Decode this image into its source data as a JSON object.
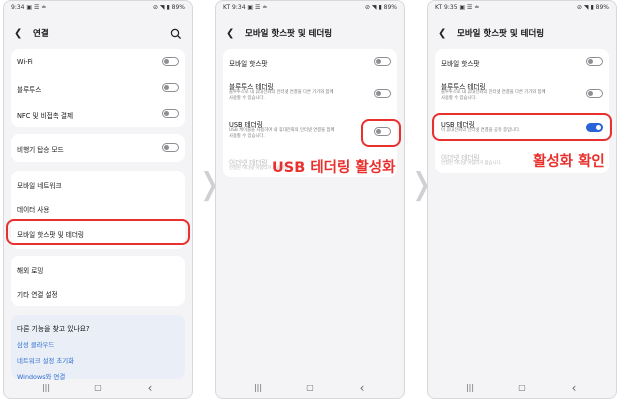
{
  "screens": [
    {
      "status_left": "9:34 ▣ ☰ ≐",
      "status_right": "⊘ ◥ ▮ 89%",
      "title": "연결",
      "items": [
        {
          "label": "Wi-Fi"
        },
        {
          "label": "블루투스"
        },
        {
          "label": "NFC 및 비접촉 결제"
        },
        {
          "label": "비행기 탑승 모드"
        },
        {
          "label": "모바일 네트워크"
        },
        {
          "label": "데이터 사용"
        },
        {
          "label": "모바일 핫스팟 및 테더링"
        },
        {
          "label": "해외 로밍"
        },
        {
          "label": "기타 연결 설정"
        }
      ],
      "suggest": {
        "title": "다른 기능을 찾고 있나요?",
        "links": [
          "삼성 클라우드",
          "네트워크 설정 초기화",
          "Windows와 연결"
        ]
      }
    },
    {
      "status_left": "KT 9:34 ▣ ☰ ≐",
      "status_right": "⊘ ◥ ▮ 89%",
      "title": "모바일 핫스팟 및 테더링",
      "items": [
        {
          "label": "모바일 핫스팟"
        },
        {
          "label": "블루투스 테더링",
          "desc1": "블루투스로 내 휴대전화의 인터넷 연결을 다른 기기와 함께",
          "desc2": "사용할 수 있습니다."
        },
        {
          "label": "USB 테더링",
          "desc1": "USB 케이블을 사용하여 내 휴대전화의 인터넷 연결을 함께",
          "desc2": "사용할 수 있습니다."
        },
        {
          "label": "이더넷 테더링",
          "desc1": "연결된 이더넷 어댑터가 없습니다."
        }
      ],
      "callout": "USB 테더링 활성화"
    },
    {
      "status_left": "KT 9:35 ▣ ☰ ≐",
      "status_right": "⊘ ◥ ▮ 89%",
      "title": "모바일 핫스팟 및 테더링",
      "items": [
        {
          "label": "모바일 핫스팟"
        },
        {
          "label": "블루투스 테더링",
          "desc1": "블루투스로 내 휴대전화의 인터넷 연결을 다른 기기와 함께",
          "desc2": "사용할 수 있습니다."
        },
        {
          "label": "USB 테더링",
          "desc1": "이 휴대전화의 인터넷 연결을 공유 중입니다."
        },
        {
          "label": "이더넷 테더링",
          "desc1": "연결된 이더넷 어댑터가 없습니다."
        }
      ],
      "callout": "활성화 확인"
    }
  ],
  "toggles": {
    "screen1": {
      "wifi": false,
      "bluetooth": false,
      "nfc": false,
      "airplane": false
    },
    "screen2": {
      "hotspot": false,
      "bt_tether": false,
      "usb_tether": false
    },
    "screen3": {
      "hotspot": false,
      "bt_tether": false,
      "usb_tether": true
    }
  },
  "nav": {
    "recent": "|||",
    "home": "▢",
    "back": "‹"
  },
  "icons": {
    "back": "back-arrow-icon",
    "search": "search-icon",
    "chevron": "chevron-right-icon"
  },
  "colors": {
    "highlight": "#e8312f",
    "toggle_on": "#2a63d8",
    "link": "#2f6ed0"
  }
}
